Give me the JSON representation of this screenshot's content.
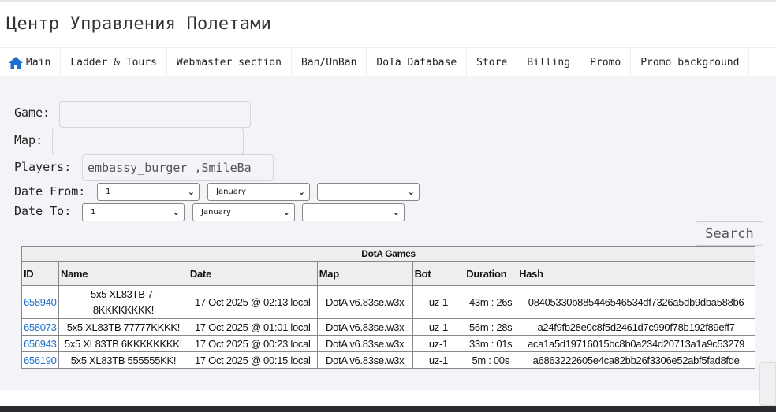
{
  "header": {
    "title": "Центр Управления Полетами"
  },
  "nav": {
    "items": [
      "Main",
      "Ladder & Tours",
      "Webmaster section",
      "Ban/UnBan",
      "DoTa Database",
      "Store",
      "Billing",
      "Promo",
      "Promo background"
    ]
  },
  "form": {
    "game_label": "Game:",
    "game_value": "",
    "map_label": "Map:",
    "map_value": "",
    "players_label": "Players:",
    "players_value": "embassy_burger  ,SmileBa",
    "date_from_label": "Date From:",
    "date_from": {
      "day": "1",
      "month": "January",
      "year": ""
    },
    "date_to_label": "Date To:",
    "date_to": {
      "day": "1",
      "month": "January",
      "year": ""
    },
    "search_label": "Search"
  },
  "table": {
    "caption": "DotA Games",
    "columns": [
      "ID",
      "Name",
      "Date",
      "Map",
      "Bot",
      "Duration",
      "Hash"
    ],
    "rows": [
      {
        "id": "658940",
        "name": "5x5 XL83TB 7-8KKKKKKKK!",
        "date": "17 Oct 2025 @ 02:13 local",
        "map": "DotA v6.83se.w3x",
        "bot": "uz-1",
        "duration": "43m : 26s",
        "hash": "08405330b885446546534df7326a5db9dba588b6"
      },
      {
        "id": "658073",
        "name": "5x5 XL83TB 77777KKKK!",
        "date": "17 Oct 2025 @ 01:01 local",
        "map": "DotA v6.83se.w3x",
        "bot": "uz-1",
        "duration": "56m : 28s",
        "hash": "a24f9fb28e0c8f5d2461d7c990f78b192f89eff7"
      },
      {
        "id": "656943",
        "name": "5x5 XL83TB 6KKKKKKKK!",
        "date": "17 Oct 2025 @ 00:23 local",
        "map": "DotA v6.83se.w3x",
        "bot": "uz-1",
        "duration": "33m : 01s",
        "hash": "aca1a5d19716015bc8b0a234d20713a1a9c53279"
      },
      {
        "id": "656190",
        "name": "5x5 XL83TB 555555KK!",
        "date": "17 Oct 2025 @ 00:15 local",
        "map": "DotA v6.83se.w3x",
        "bot": "uz-1",
        "duration": "5m : 00s",
        "hash": "a6863222605e4ca82bb26f3306e52abf5fad8fde"
      }
    ]
  },
  "colors": {
    "link": "#1a6fd0",
    "home_icon": "#1a6fd0",
    "panel_bg": "#f3f4f7"
  },
  "icons": {
    "home": "home-icon",
    "select": "chevron-down-icon"
  }
}
